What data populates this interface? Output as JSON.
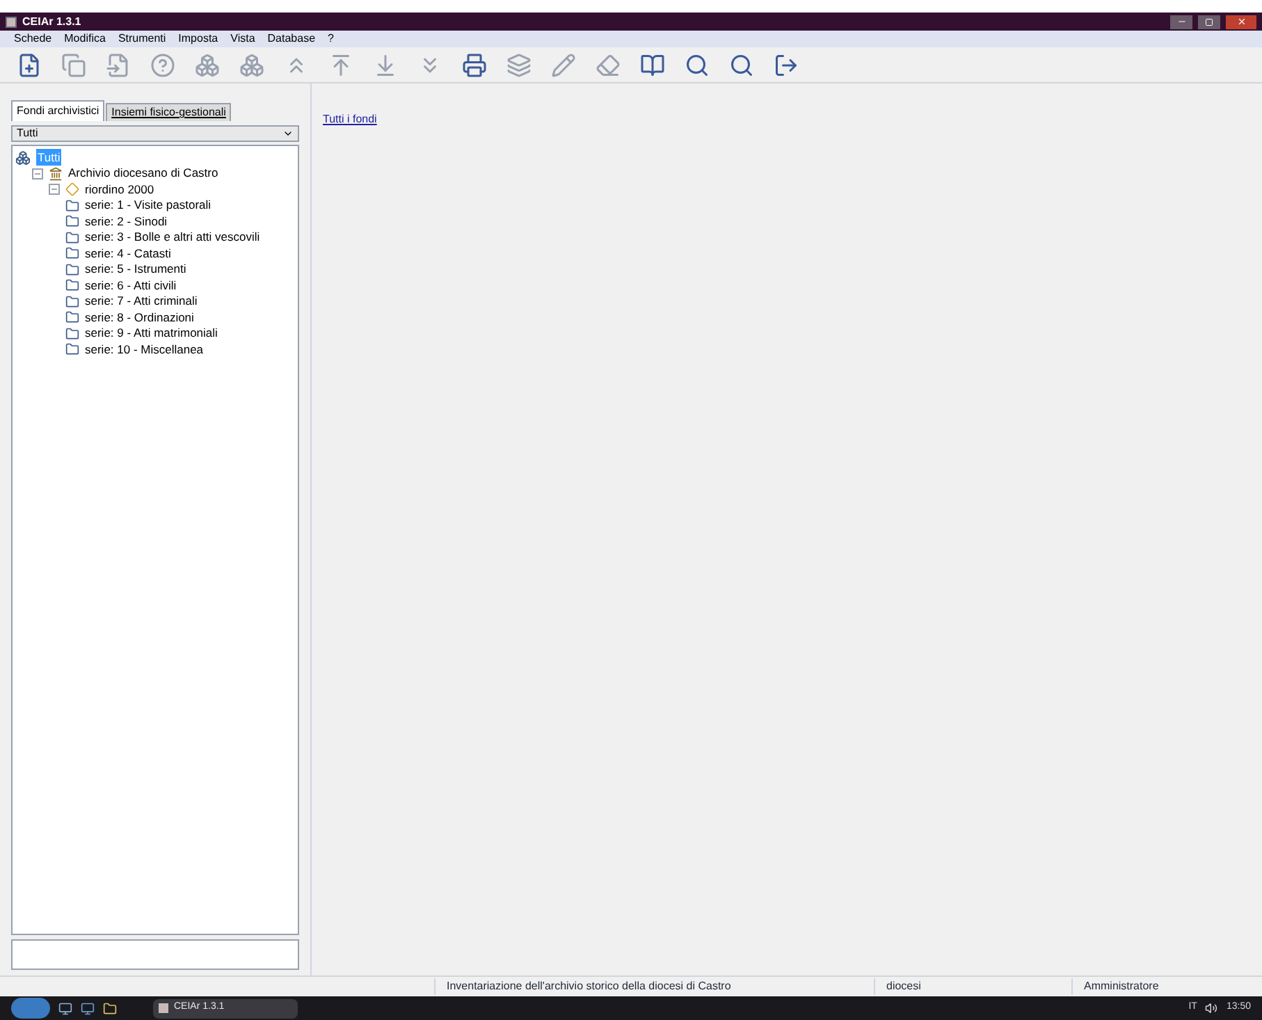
{
  "window": {
    "title": "CEIAr 1.3.1"
  },
  "menu": [
    "Schede",
    "Modifica",
    "Strumenti",
    "Imposta",
    "Vista",
    "Database",
    "?"
  ],
  "toolbar": [
    {
      "kind": "new",
      "disabled": false
    },
    {
      "kind": "copy",
      "disabled": true
    },
    {
      "kind": "move",
      "disabled": true
    },
    {
      "kind": "help",
      "disabled": true
    },
    {
      "kind": "group",
      "disabled": true
    },
    {
      "kind": "group",
      "disabled": true
    },
    {
      "kind": "top",
      "disabled": true
    },
    {
      "kind": "up",
      "disabled": true
    },
    {
      "kind": "down",
      "disabled": true
    },
    {
      "kind": "bottom",
      "disabled": true
    },
    {
      "kind": "print",
      "disabled": false
    },
    {
      "kind": "stack",
      "disabled": true
    },
    {
      "kind": "edit",
      "disabled": true
    },
    {
      "kind": "erase",
      "disabled": true
    },
    {
      "kind": "book",
      "disabled": false
    },
    {
      "kind": "search",
      "disabled": false
    },
    {
      "kind": "search",
      "disabled": false
    },
    {
      "kind": "exit",
      "disabled": false
    }
  ],
  "tabs": [
    {
      "label": "Fondi archivistici",
      "selected": true
    },
    {
      "label": "Insiemi fisico-gestionali",
      "selected": false
    }
  ],
  "filter": {
    "value": "Tutti"
  },
  "tree": {
    "label": "Tutti",
    "selected": true,
    "children": [
      {
        "label": "Archivio diocesano di Castro",
        "kind": "archive",
        "expanded": true,
        "children": [
          {
            "label": "riordino 2000",
            "kind": "reorder",
            "expanded": true,
            "children": [
              {
                "label": "serie: 1 - Visite pastorali",
                "kind": "series"
              },
              {
                "label": "serie: 2 - Sinodi",
                "kind": "series"
              },
              {
                "label": "serie: 3 - Bolle e altri atti vescovili",
                "kind": "series"
              },
              {
                "label": "serie: 4 - Catasti",
                "kind": "series"
              },
              {
                "label": "serie: 5 - Istrumenti",
                "kind": "series"
              },
              {
                "label": "serie: 6 - Atti civili",
                "kind": "series"
              },
              {
                "label": "serie: 7 - Atti criminali",
                "kind": "series"
              },
              {
                "label": "serie: 8 - Ordinazioni",
                "kind": "series"
              },
              {
                "label": "serie: 9 - Atti matrimoniali",
                "kind": "series"
              },
              {
                "label": "serie: 10 - Miscellanea",
                "kind": "series"
              }
            ]
          }
        ]
      }
    ]
  },
  "breadcrumb": "Tutti i fondi",
  "status_bar": [
    "Inventariazione dell'archivio storico della diocesi di Castro",
    "diocesi",
    "Amministratore"
  ],
  "taskbar": {
    "task": "CEIAr 1.3.1",
    "language": "IT",
    "time": "13:50"
  }
}
